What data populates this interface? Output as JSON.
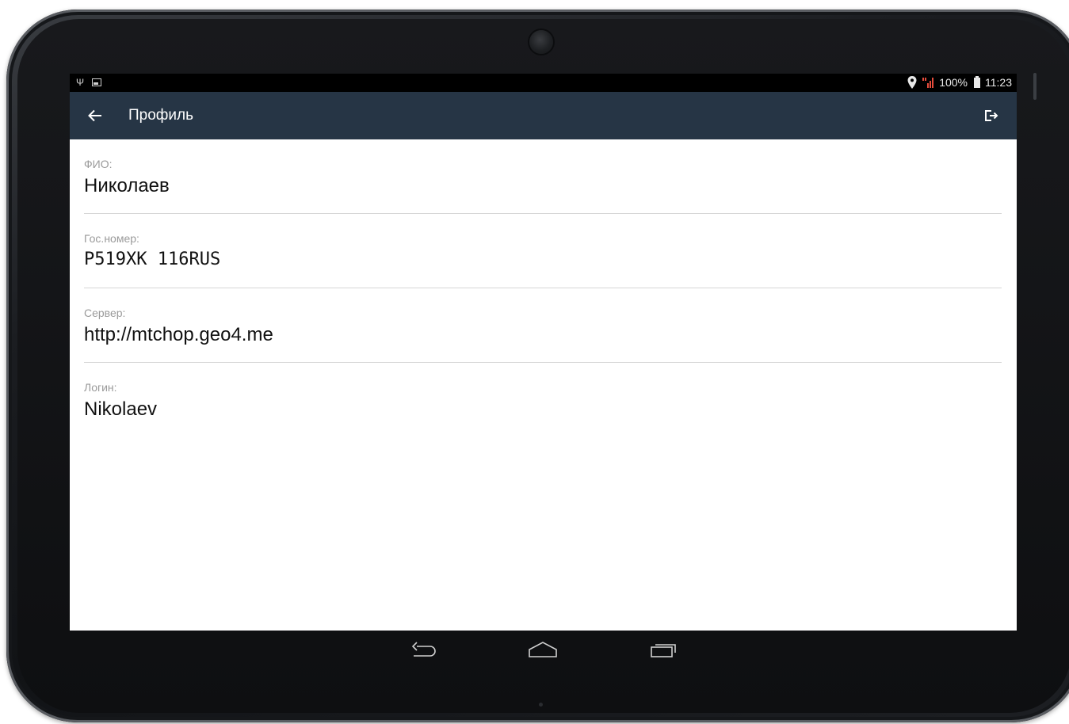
{
  "statusbar": {
    "left_icons": [
      "usb-icon",
      "image-icon"
    ],
    "battery_percent": "100%",
    "time": "11:23",
    "right_icons": [
      "location-pin-icon",
      "signal-icon",
      "battery-icon"
    ]
  },
  "appbar": {
    "title": "Профиль",
    "back_icon": "arrow-left-icon",
    "action_icon": "logout-icon",
    "background": "#263545"
  },
  "fields": [
    {
      "label": "ФИО:",
      "value": "Николаев"
    },
    {
      "label": "Гос.номер:",
      "value": "P519XK 116RUS"
    },
    {
      "label": "Сервер:",
      "value": "http://mtchop.geo4.me"
    },
    {
      "label": "Логин:",
      "value": "Nikolaev"
    }
  ],
  "navbar": {
    "buttons": [
      "back-nav-icon",
      "home-nav-icon",
      "recents-nav-icon"
    ]
  }
}
